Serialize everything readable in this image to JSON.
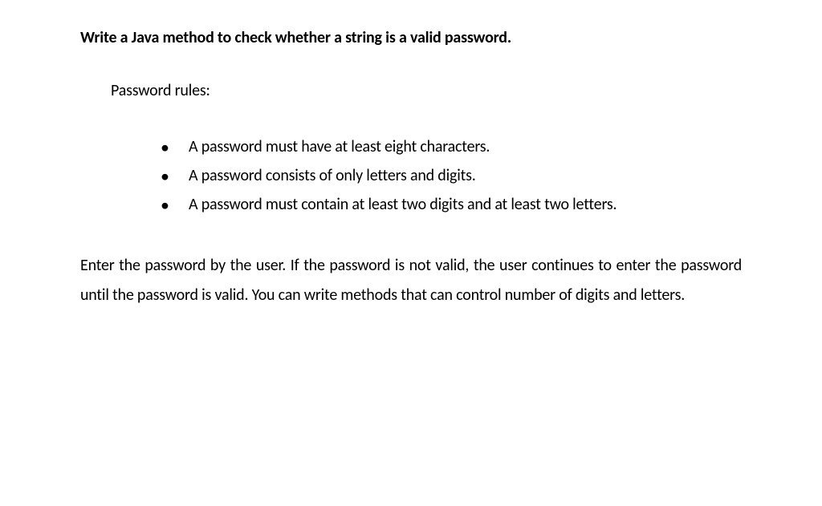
{
  "heading": "Write a Java method to check whether a string is a valid password.",
  "subheading": "Password rules:",
  "rules": [
    "A password must have at least eight characters.",
    "A password consists of only letters and digits.",
    "A password must contain at least two digits and at least two letters."
  ],
  "paragraph": "Enter the password by the user. If the password is not valid, the user continues to enter the password until the password is valid. You can write methods that can control number of digits and letters."
}
